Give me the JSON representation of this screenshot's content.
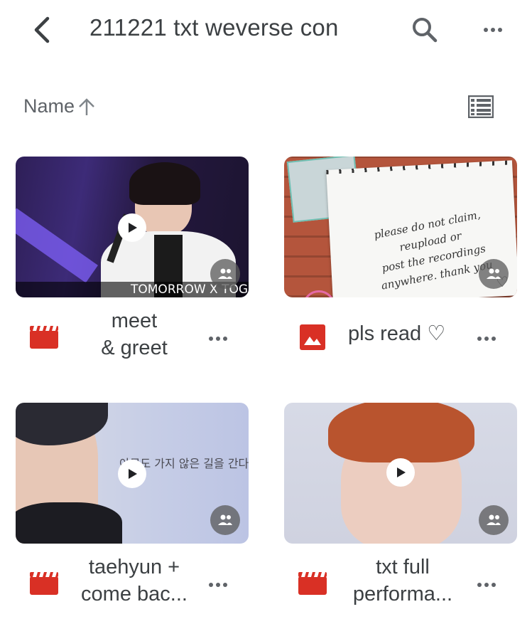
{
  "header": {
    "title": "211221 txt weverse con",
    "back_icon": "chevron-left-icon",
    "search_icon": "search-icon",
    "more_icon": "more-horizontal-icon"
  },
  "sort": {
    "label": "Name",
    "direction_icon": "arrow-up-icon",
    "view_icon": "list-view-icon"
  },
  "items": [
    {
      "name_line1": "meet",
      "name_line2": "& greet",
      "type": "video",
      "type_icon": "video-file-icon",
      "caption": "TOMORROW X TOGE",
      "shared": true
    },
    {
      "name": "pls read ♡",
      "type": "image",
      "type_icon": "image-file-icon",
      "note": {
        "line1": "please do not claim,",
        "line2": "reupload or",
        "line3": "post the recordings",
        "line4": "anywhere. thank you"
      },
      "heart": "♡",
      "shared": true
    },
    {
      "name_line1": "taehyun +",
      "name_line2": "come bac...",
      "type": "video",
      "type_icon": "video-file-icon",
      "subtitle": "아무도 가지 않은 길을 간다는 건",
      "shared": true
    },
    {
      "name_line1": "txt full",
      "name_line2": "performa...",
      "type": "video",
      "type_icon": "video-file-icon",
      "shared": true
    }
  ],
  "colors": {
    "accent_red": "#d93025",
    "icon_grey": "#5f6368",
    "text_dark": "#3c4043"
  }
}
